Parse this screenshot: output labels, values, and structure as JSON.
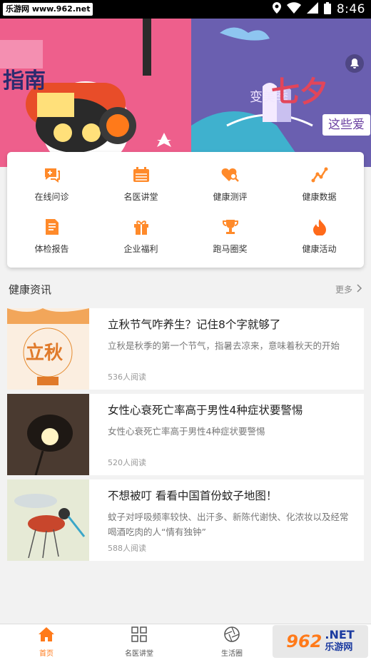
{
  "status_bar": {
    "watermark": "乐游网 www.962.net",
    "time": "8:46"
  },
  "banner": {
    "left_title": "指南",
    "right_title": "七夕",
    "right_subtitle": "变美季",
    "right_tag": "这些爱",
    "active_slide": 2,
    "slide_count": 2
  },
  "features": [
    {
      "label": "在线问诊",
      "icon": "chat-icon"
    },
    {
      "label": "名医讲堂",
      "icon": "calendar-icon"
    },
    {
      "label": "健康测评",
      "icon": "heart-search-icon"
    },
    {
      "label": "健康数据",
      "icon": "chart-icon"
    },
    {
      "label": "体检报告",
      "icon": "report-icon"
    },
    {
      "label": "企业福利",
      "icon": "gift-icon"
    },
    {
      "label": "跑马圈奖",
      "icon": "trophy-icon"
    },
    {
      "label": "健康活动",
      "icon": "flame-icon"
    }
  ],
  "section": {
    "title": "健康资讯",
    "more": "更多"
  },
  "news": [
    {
      "title": "立秋节气咋养生？记住8个字就够了",
      "summary": "立秋是秋季的第一个节气，指暑去凉来，意味着秋天的开始",
      "reads": "536人阅读",
      "thumb_text": "立秋"
    },
    {
      "title": "女性心衰死亡率高于男性4种症状要警惕",
      "summary": "女性心衰死亡率高于男性4种症状要警惕",
      "reads": "520人阅读",
      "thumb_text": ""
    },
    {
      "title": "不想被叮 看看中国首份蚊子地图！",
      "summary": "蚊子对呼吸频率较快、出汗多、新陈代谢快、化浓妆以及经常喝酒吃肉的人“情有独钟”",
      "reads": "588人阅读",
      "thumb_text": ""
    }
  ],
  "tabs": [
    {
      "label": "首页",
      "icon": "home-icon",
      "active": true
    },
    {
      "label": "名医讲堂",
      "icon": "grid-icon",
      "active": false
    },
    {
      "label": "生活圈",
      "icon": "aperture-icon",
      "active": false
    },
    {
      "label": "",
      "icon": "person-icon",
      "active": false
    }
  ],
  "bottom_watermark": {
    "num": "962",
    "net": ".NET",
    "cn": "乐游网"
  },
  "colors": {
    "accent": "#ff7a1a",
    "banner_left": "#ee5f8c",
    "banner_right": "#6a5fb0"
  }
}
